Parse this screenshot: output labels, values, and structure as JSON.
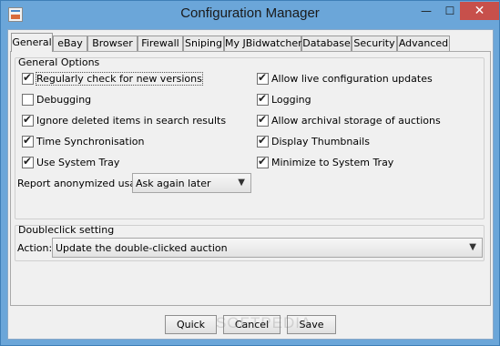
{
  "window": {
    "title": "Configuration Manager",
    "minimize_glyph": "—",
    "maximize_glyph": "☐",
    "close_glyph": "✕"
  },
  "tabs": [
    {
      "label": "General",
      "active": true
    },
    {
      "label": "eBay",
      "active": false
    },
    {
      "label": "Browser",
      "active": false
    },
    {
      "label": "Firewall",
      "active": false
    },
    {
      "label": "Sniping",
      "active": false
    },
    {
      "label": "My JBidwatcher",
      "active": false
    },
    {
      "label": "Database",
      "active": false
    },
    {
      "label": "Security",
      "active": false
    },
    {
      "label": "Advanced",
      "active": false
    }
  ],
  "general_options": {
    "title": "General Options",
    "left": [
      {
        "label": "Regularly check for new versions",
        "checked": true,
        "focused": true
      },
      {
        "label": "Debugging",
        "checked": false
      },
      {
        "label": "Ignore deleted items in search results",
        "checked": true
      },
      {
        "label": "Time Synchronisation",
        "checked": true
      },
      {
        "label": "Use System Tray",
        "checked": true
      }
    ],
    "right": [
      {
        "label": "Allow live configuration updates",
        "checked": true
      },
      {
        "label": "Logging",
        "checked": true
      },
      {
        "label": "Allow archival storage of auctions",
        "checked": true
      },
      {
        "label": "Display Thumbnails",
        "checked": true
      },
      {
        "label": "Minimize to System Tray",
        "checked": true
      }
    ],
    "anonymized_usage": {
      "label": "Report anonymized usage",
      "selected": "Ask again later"
    }
  },
  "doubleclick": {
    "title": "Doubleclick setting",
    "action_label": "Action:",
    "selected": "Update the double-clicked auction"
  },
  "buttons": {
    "quick": "Quick",
    "cancel": "Cancel",
    "save": "Save"
  },
  "watermark": "SOFTPEDIA"
}
